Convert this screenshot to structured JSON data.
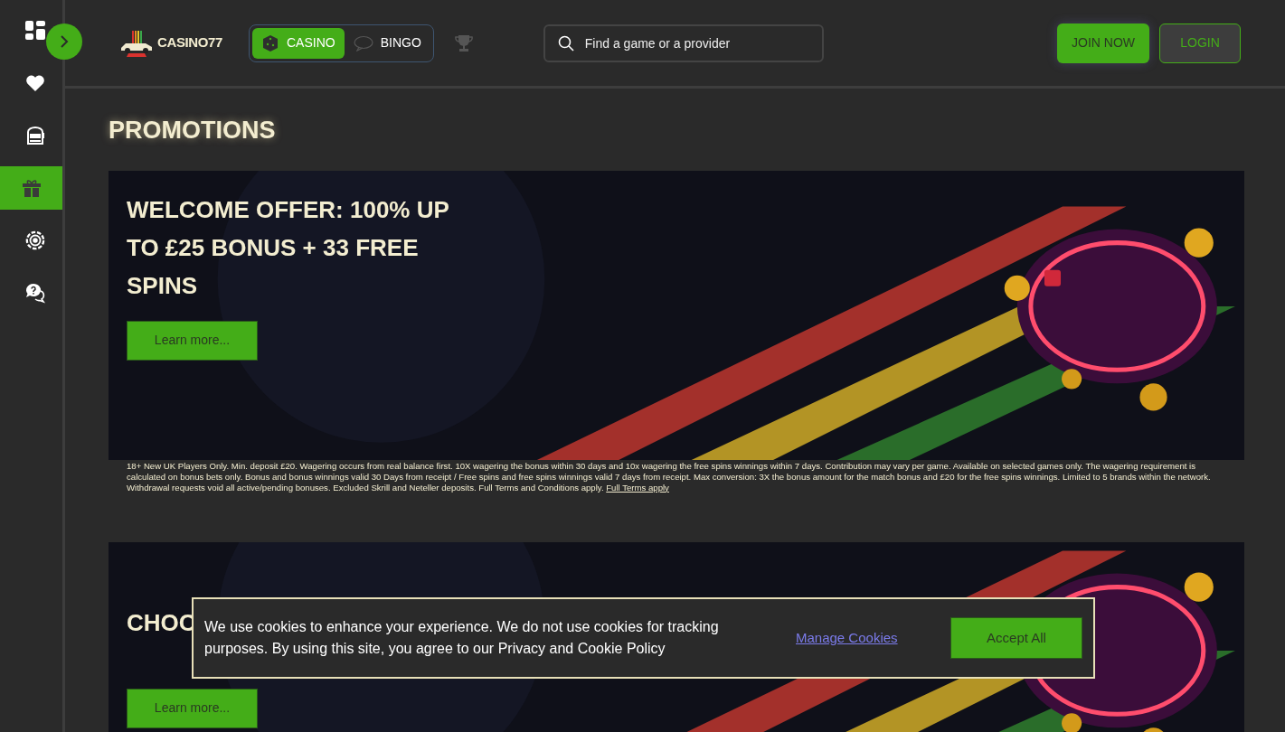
{
  "sidebar": {
    "items": [
      {
        "kind": "grid",
        "selected": false
      },
      {
        "kind": "heart",
        "selected": false
      },
      {
        "kind": "slot",
        "selected": false
      },
      {
        "kind": "gift",
        "selected": true
      },
      {
        "kind": "chip",
        "selected": false
      },
      {
        "kind": "help",
        "selected": false
      }
    ]
  },
  "header": {
    "logo": "CASINO77",
    "tabs": [
      {
        "label": "CASINO",
        "kind": "dice",
        "selected": true
      },
      {
        "label": "BINGO",
        "kind": "bingo",
        "selected": false
      }
    ],
    "search": {
      "placeholder": "Find a game or a provider"
    },
    "buttons": {
      "join": "JOIN NOW",
      "login": "LOGIN"
    }
  },
  "page_title": "PROMOTIONS",
  "promotions": [
    {
      "title": "WELCOME OFFER: 100% UP TO £25 BONUS + 33 FREE SPINS",
      "button": "Learn more...",
      "terms": "18+ New UK Players Only. Min. deposit £20. Wagering occurs from real balance first. 10X wagering the bonus within 30 days and 10x wagering the free spins winnings within 7 days. Contribution may vary per game. Available on selected games only. The wagering requirement is calculated on bonus bets only. Bonus and bonus winnings valid 30 Days from receipt / Free spins and free spins winnings valid 7 days from receipt. Max conversion: 3X the bonus amount for the match bonus and £20 for the free spins winnings. Limited to 5 brands within the network. Withdrawal requests void all active/pending bonuses. Excluded Skrill and Neteller deposits. Full Terms and Conditions apply.",
      "terms_link": "Full Terms apply"
    },
    {
      "title": "CHOO",
      "button": "Learn more..."
    }
  ],
  "cookie_banner": {
    "text": "We use cookies to enhance your experience. We do not use cookies for tracking purposes. By using this site, you agree to our Privacy and Cookie Policy",
    "manage": "Manage Cookies",
    "accept": "Accept All"
  }
}
